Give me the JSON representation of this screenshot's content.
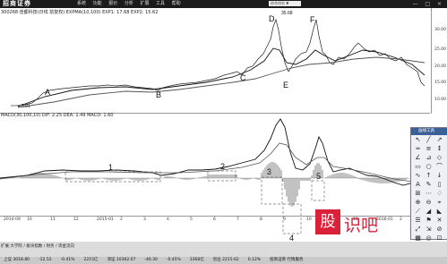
{
  "window": {
    "logo": "招商证券",
    "menu": [
      "系统",
      "功能",
      "报价",
      "分析",
      "扩展",
      "工具",
      "帮助"
    ],
    "search_value": "综合排名 ▼",
    "controls": "— □ ×"
  },
  "price_panel": {
    "header": "300268  佳都科技(日线 前复权)  EXPMA(10,100)  EXP1: 17.68  EXP2: 15.62",
    "high_label": "35.68",
    "low_label": "5.91",
    "axis_ticks": [
      "30.00",
      "25.00",
      "20.00",
      "15.00",
      "10.00"
    ],
    "points": [
      "A",
      "B",
      "C",
      "D",
      "E",
      "F"
    ]
  },
  "macd_panel": {
    "header": "MACD(30,100,10)  DIF: 2.25  DEA: 1.49  MACD: 1.60",
    "regions": [
      "1",
      "2",
      "3",
      "4",
      "5"
    ]
  },
  "date_axis": [
    "2014-09",
    "10",
    "11",
    "12",
    "2015-01",
    "2",
    "3",
    "4",
    "5",
    "6",
    "7",
    "8",
    "9",
    "10",
    "11",
    "12",
    "2016-01",
    "2"
  ],
  "toolbox": {
    "title": "画线工具",
    "tools": [
      "↖",
      "╱",
      "↗",
      "═",
      "≡",
      "↕",
      "∠",
      "⊿",
      "◇",
      "▭",
      "○",
      "⌒",
      "∿",
      "↑",
      "↓",
      "A",
      "✎",
      "▯",
      "⊞",
      "⋯",
      "♢",
      "⊕",
      "⊖",
      "⌖",
      "⟋",
      "◢",
      "◣",
      "☰",
      "⚑",
      "✕",
      "⤢",
      "⇲",
      "⊘",
      "▦",
      "◎",
      "⊡"
    ]
  },
  "tabs": "扩展  大学院 / 板块指数 / 财务 / 资金流向",
  "status": [
    "上证 3018.80",
    "-12.52",
    "-0.41%",
    "2215亿",
    "深证 10362.07",
    "-46.30",
    "-0.45%",
    "3368亿",
    "创业 2215.62",
    "0.12%",
    "招商证券 行情服务"
  ],
  "watermark": {
    "box": "股",
    "text": "识吧"
  },
  "colors": {
    "price": "#222222",
    "ema1": "#111111",
    "ema2": "#555555",
    "region_box": "#777777",
    "watermark": "#d9223a"
  }
}
